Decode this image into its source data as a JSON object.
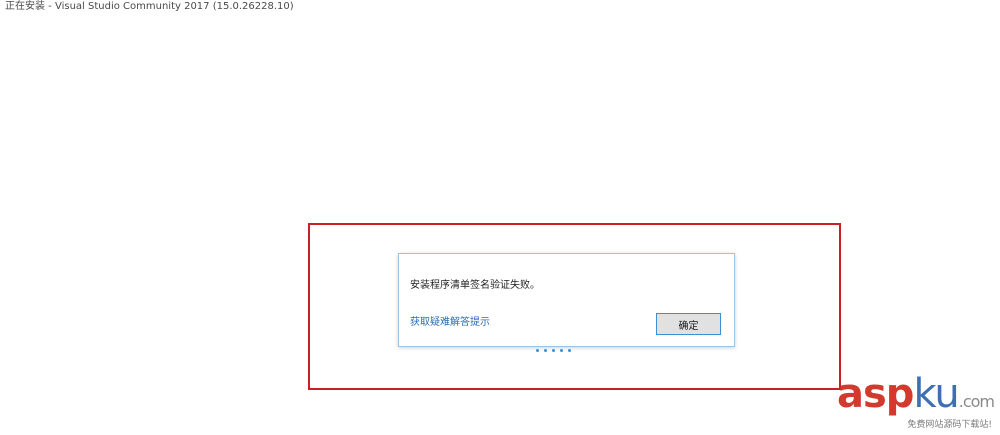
{
  "window": {
    "title": "正在安装 - Visual Studio Community 2017 (15.0.26228.10)"
  },
  "dialog": {
    "message": "安装程序清单签名验证失败。",
    "help_link": "获取疑难解答提示",
    "ok_label": "确定"
  },
  "progress": {
    "dot_count": 5
  },
  "watermark": {
    "logo_asp": "asp",
    "logo_ku": "ku",
    "logo_com": ".com",
    "tagline": "免费网站源码下载站!"
  },
  "colors": {
    "highlight_frame": "#cc1f24",
    "accent": "#3c8fd6",
    "link": "#2e6db5"
  }
}
